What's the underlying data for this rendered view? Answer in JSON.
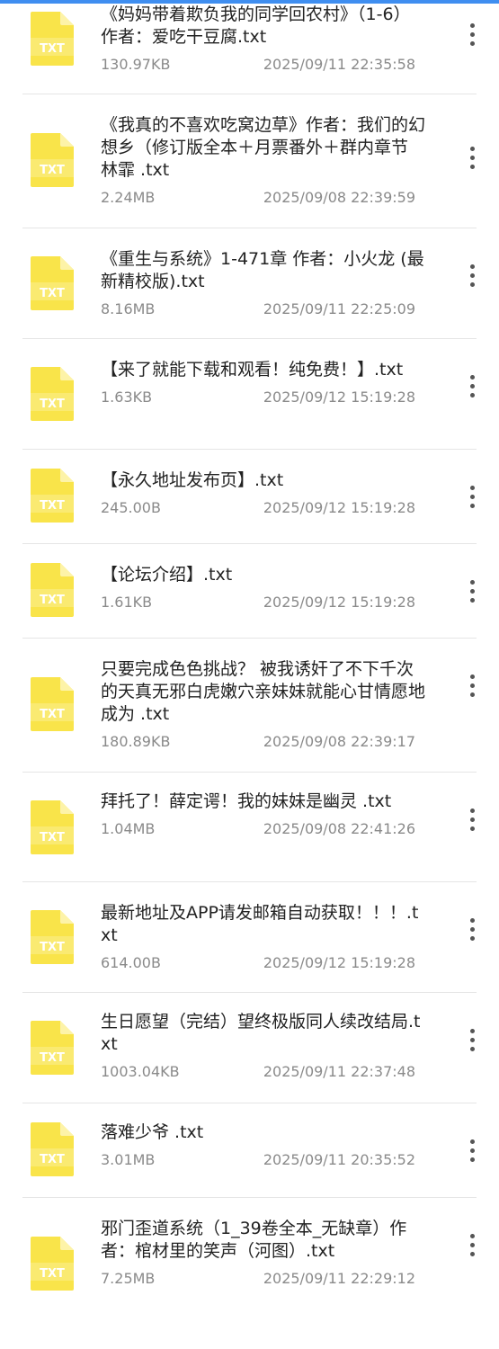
{
  "icon": {
    "name": "txt-file-icon",
    "label": "TXT",
    "color": "#f9e44a",
    "fold_color": "#fdf3a8"
  },
  "files": [
    {
      "title": "《妈妈带着欺负我的同学回农村》（1-6）作者：爱吃干豆腐.txt",
      "size": "130.97KB",
      "date": "2025/09/11 22:35:58"
    },
    {
      "title": "《我真的不喜欢吃窝边草》作者：我们的幻想乡（修订版全本＋月票番外＋群内章节 林霏 .txt",
      "size": "2.24MB",
      "date": "2025/09/08 22:39:59"
    },
    {
      "title": "《重生与系统》1-471章 作者：小火龙 (最新精校版).txt",
      "size": "8.16MB",
      "date": "2025/09/11 22:25:09"
    },
    {
      "title": "【来了就能下载和观看！纯免费！】.txt",
      "size": "1.63KB",
      "date": "2025/09/12 15:19:28"
    },
    {
      "title": "【永久地址发布页】.txt",
      "size": "245.00B",
      "date": "2025/09/12 15:19:28"
    },
    {
      "title": "【论坛介绍】.txt",
      "size": "1.61KB",
      "date": "2025/09/12 15:19:28"
    },
    {
      "title": "只要完成色色挑战？ 被我诱奸了不下千次的天真无邪白虎嫩穴亲妹妹就能心甘情愿地成为 .txt",
      "size": "180.89KB",
      "date": "2025/09/08 22:39:17"
    },
    {
      "title": "拜托了！薛定谔！我的妹妹是幽灵 .txt",
      "size": "1.04MB",
      "date": "2025/09/08 22:41:26"
    },
    {
      "title": "最新地址及APP请发邮箱自动获取！！！.txt",
      "size": "614.00B",
      "date": "2025/09/12 15:19:28"
    },
    {
      "title": "生日愿望（完结）望终极版同人续改结局.txt",
      "size": "1003.04KB",
      "date": "2025/09/11 22:37:48"
    },
    {
      "title": "落难少爷 .txt",
      "size": "3.01MB",
      "date": "2025/09/11 20:35:52"
    },
    {
      "title": "邪门歪道系统（1_39卷全本_无缺章）作者：棺材里的笑声（河图）.txt",
      "size": "7.25MB",
      "date": "2025/09/11 22:29:12"
    }
  ]
}
